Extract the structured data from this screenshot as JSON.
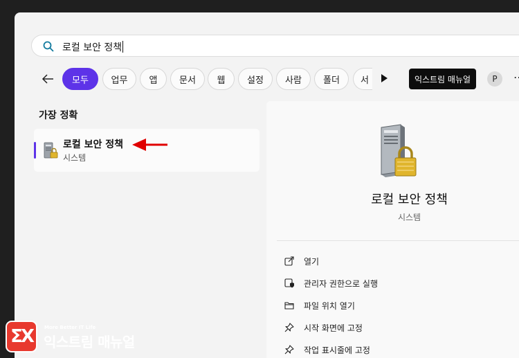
{
  "search": {
    "query": "로컬 보안 정책"
  },
  "filters": {
    "chips": [
      "모두",
      "업무",
      "앱",
      "문서",
      "웹",
      "설정",
      "사람",
      "폴더",
      "서"
    ],
    "brand_chip": "익스트림 매뉴얼",
    "avatar": "P",
    "more": "⋯"
  },
  "results": {
    "section_title": "가장 정확",
    "best_match": {
      "name": "로컬 보안 정책",
      "type": "시스템"
    }
  },
  "detail": {
    "title": "로컬 보안 정책",
    "subtitle": "시스템",
    "actions": [
      "열기",
      "관리자 권한으로 실행",
      "파일 위치 열기",
      "시작 화면에 고정",
      "작업 표시줄에 고정"
    ]
  },
  "watermark": {
    "tagline": "More Better IT Life",
    "brand": "익스트림 매뉴얼"
  },
  "colors": {
    "accent": "#5d33e8",
    "arrow": "#e00000",
    "logo": "#e8392e"
  }
}
